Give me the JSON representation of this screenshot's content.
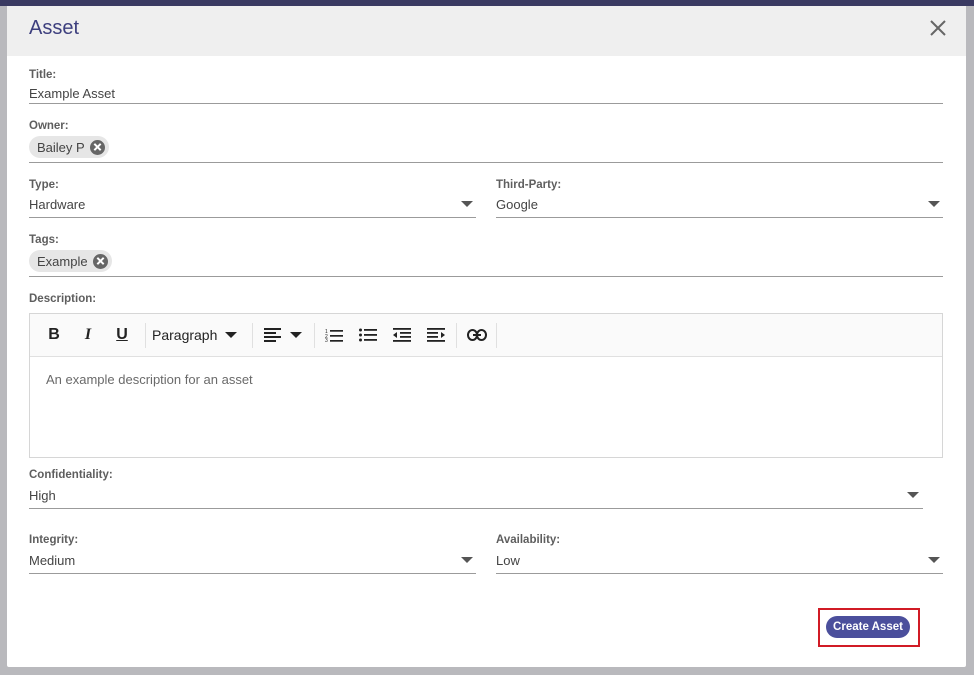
{
  "modal": {
    "title": "Asset",
    "close_icon": "close-icon"
  },
  "fields": {
    "title": {
      "label": "Title:",
      "value": "Example Asset"
    },
    "owner": {
      "label": "Owner:",
      "chips": [
        "Bailey P"
      ]
    },
    "type": {
      "label": "Type:",
      "value": "Hardware"
    },
    "third_party": {
      "label": "Third-Party:",
      "value": "Google"
    },
    "tags": {
      "label": "Tags:",
      "chips": [
        "Example"
      ]
    },
    "description": {
      "label": "Description:",
      "content": "An example description for an asset",
      "block_format": "Paragraph",
      "toolbar": [
        "bold-icon",
        "italic-icon",
        "underline-icon",
        "block-format-dropdown",
        "align-left-icon",
        "numbered-list-icon",
        "bulleted-list-icon",
        "outdent-icon",
        "indent-icon",
        "link-icon"
      ]
    },
    "confidentiality": {
      "label": "Confidentiality:",
      "value": "High"
    },
    "integrity": {
      "label": "Integrity:",
      "value": "Medium"
    },
    "availability": {
      "label": "Availability:",
      "value": "Low"
    }
  },
  "actions": {
    "create_label": "Create Asset"
  },
  "colors": {
    "title": "#3d3f7e",
    "primary_button": "#4b4f9c",
    "highlight_border": "#d11b25",
    "top_band": "#3a3a62"
  }
}
